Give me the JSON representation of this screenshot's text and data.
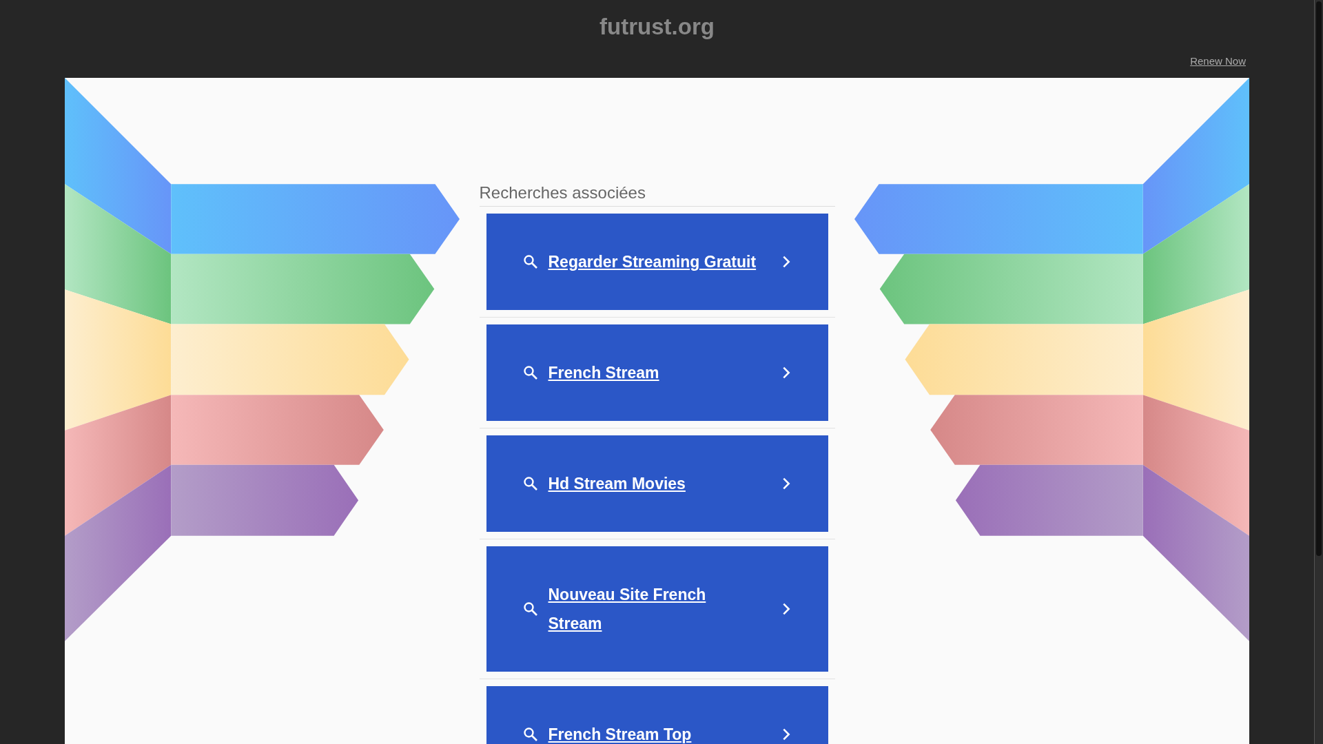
{
  "header": {
    "title": "futrust.org",
    "renew_link": "Renew Now"
  },
  "related": {
    "heading": "Recherches associées",
    "links": [
      {
        "label": "Regarder Streaming Gratuit"
      },
      {
        "label": "French Stream"
      },
      {
        "label": "Hd Stream Movies"
      },
      {
        "label": "Nouveau Site French\nStream"
      },
      {
        "label": "French Stream Top"
      }
    ]
  }
}
